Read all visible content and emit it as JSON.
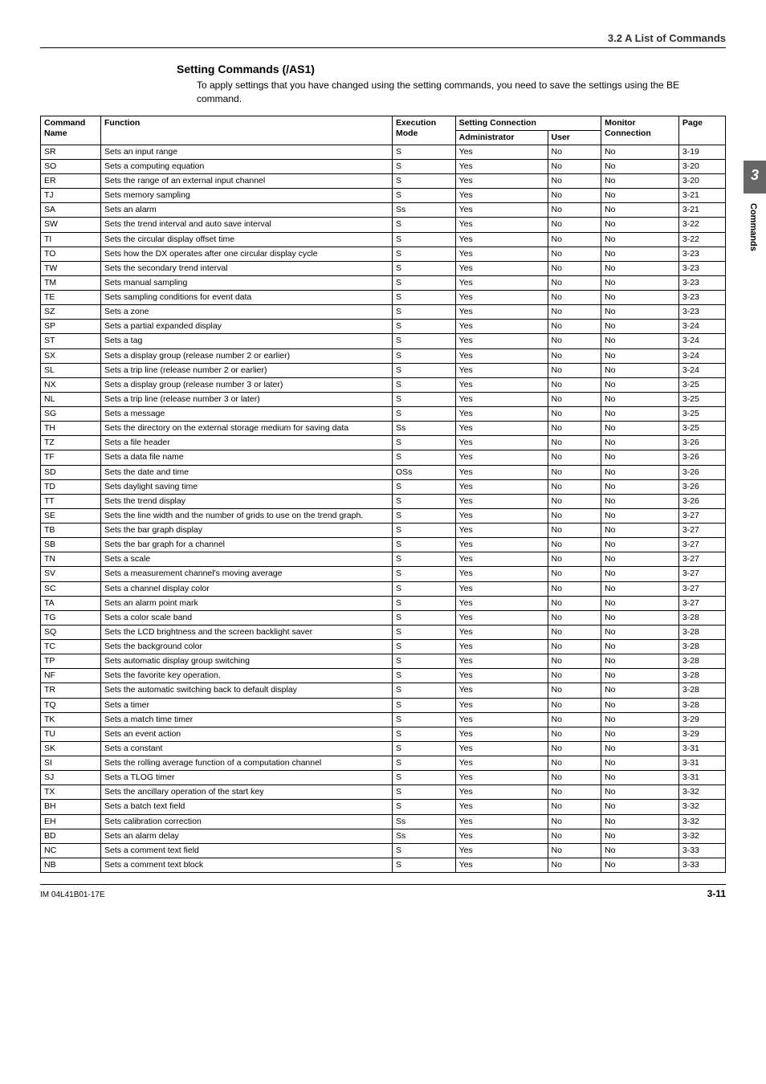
{
  "doc": {
    "section_ref": "3.2  A List of Commands",
    "setting_title": "Setting Commands (/AS1)",
    "setting_desc": "To apply settings that you have changed using the setting commands, you need to save the settings using the BE command.",
    "side_chapter": "3",
    "side_label": "Commands",
    "footer_left": "IM 04L41B01-17E",
    "footer_right": "3-11"
  },
  "headers": {
    "cmd": "Command Name",
    "func": "Function",
    "exec": "Execution Mode",
    "setting_conn": "Setting Connection",
    "admin": "Administrator",
    "user": "User",
    "monitor": "Monitor Connection",
    "page": "Page"
  },
  "rows": [
    {
      "c": "SR",
      "f": "Sets an input range",
      "m": "S",
      "a": "Yes",
      "u": "No",
      "mc": "No",
      "p": "3-19"
    },
    {
      "c": "SO",
      "f": "Sets a computing equation",
      "m": "S",
      "a": "Yes",
      "u": "No",
      "mc": "No",
      "p": "3-20"
    },
    {
      "c": "ER",
      "f": "Sets the range of an external input channel",
      "m": "S",
      "a": "Yes",
      "u": "No",
      "mc": "No",
      "p": "3-20"
    },
    {
      "c": "TJ",
      "f": "Sets memory sampling",
      "m": "S",
      "a": "Yes",
      "u": "No",
      "mc": "No",
      "p": "3-21"
    },
    {
      "c": "SA",
      "f": "Sets an alarm",
      "m": "Ss",
      "a": "Yes",
      "u": "No",
      "mc": "No",
      "p": "3-21"
    },
    {
      "c": "SW",
      "f": "Sets the trend interval and auto save interval",
      "m": "S",
      "a": "Yes",
      "u": "No",
      "mc": "No",
      "p": "3-22"
    },
    {
      "c": "TI",
      "f": "Sets the circular display offset time",
      "m": "S",
      "a": "Yes",
      "u": "No",
      "mc": "No",
      "p": "3-22"
    },
    {
      "c": "TO",
      "f": "Sets how the DX operates after one circular display cycle",
      "m": "S",
      "a": "Yes",
      "u": "No",
      "mc": "No",
      "p": "3-23"
    },
    {
      "c": "TW",
      "f": "Sets the secondary trend interval",
      "m": "S",
      "a": "Yes",
      "u": "No",
      "mc": "No",
      "p": "3-23"
    },
    {
      "c": "TM",
      "f": "Sets manual sampling",
      "m": "S",
      "a": "Yes",
      "u": "No",
      "mc": "No",
      "p": "3-23"
    },
    {
      "c": "TE",
      "f": "Sets sampling conditions for event data",
      "m": "S",
      "a": "Yes",
      "u": "No",
      "mc": "No",
      "p": "3-23"
    },
    {
      "c": "SZ",
      "f": "Sets a zone",
      "m": "S",
      "a": "Yes",
      "u": "No",
      "mc": "No",
      "p": "3-23"
    },
    {
      "c": "SP",
      "f": "Sets a partial expanded display",
      "m": "S",
      "a": "Yes",
      "u": "No",
      "mc": "No",
      "p": "3-24"
    },
    {
      "c": "ST",
      "f": "Sets a tag",
      "m": "S",
      "a": "Yes",
      "u": "No",
      "mc": "No",
      "p": "3-24"
    },
    {
      "c": "SX",
      "f": "Sets a display group (release number 2 or earlier)",
      "m": "S",
      "a": "Yes",
      "u": "No",
      "mc": "No",
      "p": "3-24"
    },
    {
      "c": "SL",
      "f": "Sets a trip line (release number 2 or earlier)",
      "m": "S",
      "a": "Yes",
      "u": "No",
      "mc": "No",
      "p": "3-24"
    },
    {
      "c": "NX",
      "f": "Sets a display group (release number 3 or later)",
      "m": "S",
      "a": "Yes",
      "u": "No",
      "mc": "No",
      "p": "3-25"
    },
    {
      "c": "NL",
      "f": "Sets a trip line (release number 3 or later)",
      "m": "S",
      "a": "Yes",
      "u": "No",
      "mc": "No",
      "p": "3-25"
    },
    {
      "c": "SG",
      "f": "Sets a message",
      "m": "S",
      "a": "Yes",
      "u": "No",
      "mc": "No",
      "p": "3-25"
    },
    {
      "c": "TH",
      "f": "Sets the directory on the external storage medium for saving data",
      "m": "Ss",
      "a": "Yes",
      "u": "No",
      "mc": "No",
      "p": "3-25"
    },
    {
      "c": "TZ",
      "f": "Sets a file header",
      "m": "S",
      "a": "Yes",
      "u": "No",
      "mc": "No",
      "p": "3-26"
    },
    {
      "c": "TF",
      "f": "Sets a data file name",
      "m": "S",
      "a": "Yes",
      "u": "No",
      "mc": "No",
      "p": "3-26"
    },
    {
      "c": "SD",
      "f": "Sets the date and time",
      "m": "OSs",
      "a": "Yes",
      "u": "No",
      "mc": "No",
      "p": "3-26"
    },
    {
      "c": "TD",
      "f": "Sets daylight saving time",
      "m": "S",
      "a": "Yes",
      "u": "No",
      "mc": "No",
      "p": "3-26"
    },
    {
      "c": "TT",
      "f": "Sets the trend display",
      "m": "S",
      "a": "Yes",
      "u": "No",
      "mc": "No",
      "p": "3-26"
    },
    {
      "c": "SE",
      "f": "Sets the line width and the number of grids to use on the trend graph.",
      "m": "S",
      "a": "Yes",
      "u": "No",
      "mc": "No",
      "p": "3-27"
    },
    {
      "c": "TB",
      "f": "Sets the bar graph display",
      "m": "S",
      "a": "Yes",
      "u": "No",
      "mc": "No",
      "p": "3-27"
    },
    {
      "c": "SB",
      "f": "Sets the bar graph for a channel",
      "m": "S",
      "a": "Yes",
      "u": "No",
      "mc": "No",
      "p": "3-27"
    },
    {
      "c": "TN",
      "f": "Sets a scale",
      "m": "S",
      "a": "Yes",
      "u": "No",
      "mc": "No",
      "p": "3-27"
    },
    {
      "c": "SV",
      "f": "Sets a measurement channel's moving average",
      "m": "S",
      "a": "Yes",
      "u": "No",
      "mc": "No",
      "p": "3-27"
    },
    {
      "c": "SC",
      "f": "Sets a channel display color",
      "m": "S",
      "a": "Yes",
      "u": "No",
      "mc": "No",
      "p": "3-27"
    },
    {
      "c": "TA",
      "f": "Sets an alarm point mark",
      "m": "S",
      "a": "Yes",
      "u": "No",
      "mc": "No",
      "p": "3-27"
    },
    {
      "c": "TG",
      "f": "Sets a color scale band",
      "m": "S",
      "a": "Yes",
      "u": "No",
      "mc": "No",
      "p": "3-28"
    },
    {
      "c": "SQ",
      "f": "Sets the LCD brightness and the screen backlight saver",
      "m": "S",
      "a": "Yes",
      "u": "No",
      "mc": "No",
      "p": "3-28"
    },
    {
      "c": "TC",
      "f": "Sets the background color",
      "m": "S",
      "a": "Yes",
      "u": "No",
      "mc": "No",
      "p": "3-28"
    },
    {
      "c": "TP",
      "f": "Sets automatic display group switching",
      "m": "S",
      "a": "Yes",
      "u": "No",
      "mc": "No",
      "p": "3-28"
    },
    {
      "c": "NF",
      "f": "Sets the favorite key operation.",
      "m": "S",
      "a": "Yes",
      "u": "No",
      "mc": "No",
      "p": "3-28"
    },
    {
      "c": "TR",
      "f": "Sets the automatic switching back to default display",
      "m": "S",
      "a": "Yes",
      "u": "No",
      "mc": "No",
      "p": "3-28"
    },
    {
      "c": "TQ",
      "f": "Sets a timer",
      "m": "S",
      "a": "Yes",
      "u": "No",
      "mc": "No",
      "p": "3-28"
    },
    {
      "c": "TK",
      "f": "Sets a match time timer",
      "m": "S",
      "a": "Yes",
      "u": "No",
      "mc": "No",
      "p": "3-29"
    },
    {
      "c": "TU",
      "f": "Sets an event action",
      "m": "S",
      "a": "Yes",
      "u": "No",
      "mc": "No",
      "p": "3-29"
    },
    {
      "c": "SK",
      "f": "Sets a constant",
      "m": "S",
      "a": "Yes",
      "u": "No",
      "mc": "No",
      "p": "3-31"
    },
    {
      "c": "SI",
      "f": "Sets the rolling average function of a computation channel",
      "m": "S",
      "a": "Yes",
      "u": "No",
      "mc": "No",
      "p": "3-31"
    },
    {
      "c": "SJ",
      "f": "Sets a TLOG timer",
      "m": "S",
      "a": "Yes",
      "u": "No",
      "mc": "No",
      "p": "3-31"
    },
    {
      "c": "TX",
      "f": "Sets the ancillary operation of the start key",
      "m": "S",
      "a": "Yes",
      "u": "No",
      "mc": "No",
      "p": "3-32"
    },
    {
      "c": "BH",
      "f": "Sets a batch text field",
      "m": "S",
      "a": "Yes",
      "u": "No",
      "mc": "No",
      "p": "3-32"
    },
    {
      "c": "EH",
      "f": "Sets calibration correction",
      "m": "Ss",
      "a": "Yes",
      "u": "No",
      "mc": "No",
      "p": "3-32"
    },
    {
      "c": "BD",
      "f": "Sets an alarm delay",
      "m": "Ss",
      "a": "Yes",
      "u": "No",
      "mc": "No",
      "p": "3-32"
    },
    {
      "c": "NC",
      "f": "Sets a comment text field",
      "m": "S",
      "a": "Yes",
      "u": "No",
      "mc": "No",
      "p": "3-33"
    },
    {
      "c": "NB",
      "f": "Sets a comment text block",
      "m": "S",
      "a": "Yes",
      "u": "No",
      "mc": "No",
      "p": "3-33"
    }
  ]
}
